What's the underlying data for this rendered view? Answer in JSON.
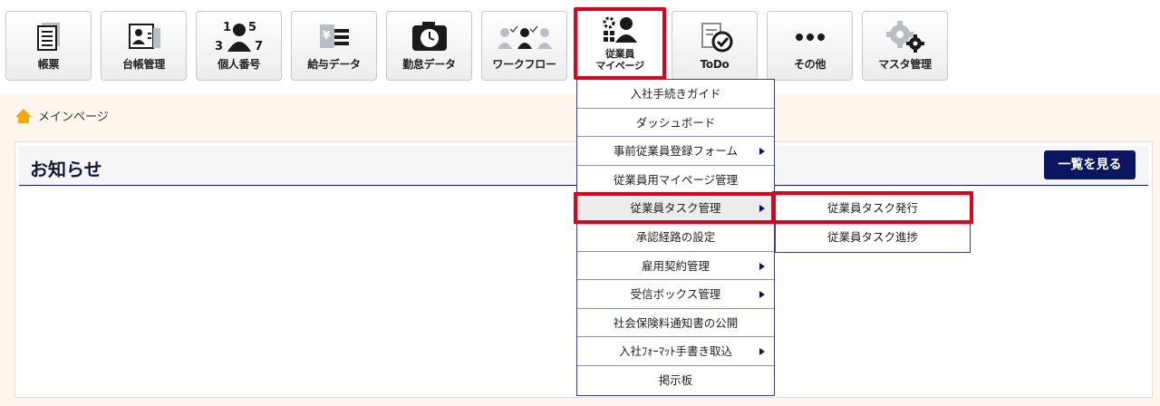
{
  "toolbar": {
    "items": [
      {
        "label": "帳票",
        "icon": "report-icon"
      },
      {
        "label": "台帳管理",
        "icon": "ledger-icon"
      },
      {
        "label": "個人番号",
        "icon": "personal-number-icon"
      },
      {
        "label": "給与データ",
        "icon": "salary-icon"
      },
      {
        "label": "勤怠データ",
        "icon": "attendance-icon"
      },
      {
        "label": "ワークフロー",
        "icon": "workflow-icon"
      },
      {
        "label_line1": "従業員",
        "label_line2": "マイページ",
        "icon": "employee-mypage-icon"
      },
      {
        "label": "ToDo",
        "icon": "todo-icon"
      },
      {
        "label": "その他",
        "icon": "more-icon"
      },
      {
        "label": "マスタ管理",
        "icon": "master-gears-icon"
      }
    ]
  },
  "breadcrumb": {
    "label": "メインページ"
  },
  "notice": {
    "title": "お知らせ",
    "view_all": "一覧を見る"
  },
  "dropdown": {
    "items": [
      {
        "label": "入社手続きガイド"
      },
      {
        "label": "ダッシュボード"
      },
      {
        "label": "事前従業員登録フォーム"
      },
      {
        "label": "従業員用マイページ管理"
      },
      {
        "label": "従業員タスク管理"
      },
      {
        "label": "承認経路の設定"
      },
      {
        "label": "雇用契約管理"
      },
      {
        "label": "受信ボックス管理"
      },
      {
        "label": "社会保険料通知書の公開"
      },
      {
        "label": "入社ﾌｫｰﾏｯﾄ手書き取込"
      },
      {
        "label": "掲示板"
      }
    ]
  },
  "submenu": {
    "items": [
      {
        "label": "従業員タスク発行"
      },
      {
        "label": "従業員タスク進捗"
      }
    ]
  },
  "colors": {
    "navy": "#0b1660",
    "highlight": "#e0001b",
    "background": "#fdf6ec"
  }
}
